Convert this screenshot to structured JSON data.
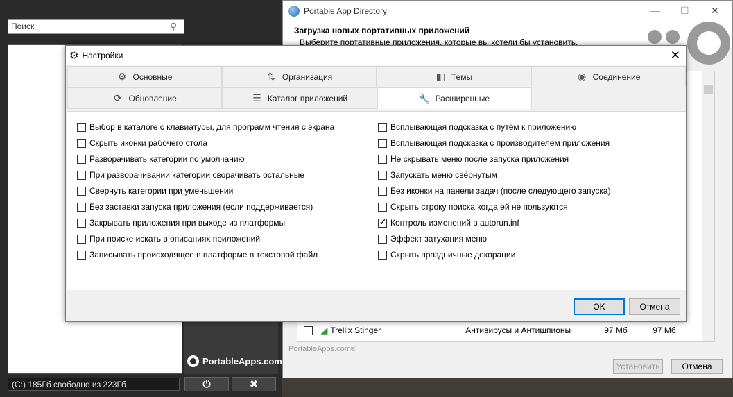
{
  "launcher": {
    "search_placeholder": "Поиск",
    "logo_text": "PortableApps.com",
    "drive_status": "(C:) 185Гб свободно из 223Гб",
    "power_icon": "power-icon",
    "close_icon": "close-icon"
  },
  "directory": {
    "title": "Portable App Directory",
    "heading": "Загрузка новых портативных приложений",
    "subheading": "Выберите портативные приложения, которые вы хотели бы установить.",
    "row": {
      "name": "Trellix Stinger",
      "category": "Антивирусы и Антишпионы",
      "size1": "97 Мб",
      "size2": "97 Мб"
    },
    "footer": "PortableApps.com®",
    "install_label": "Установить",
    "cancel_label": "Отмена"
  },
  "dialog": {
    "title": "Настройки",
    "tabs_row1": [
      {
        "label": "Основные",
        "icon": "gear-icon"
      },
      {
        "label": "Организация",
        "icon": "sort-icon"
      },
      {
        "label": "Темы",
        "icon": "theme-icon"
      },
      {
        "label": "Соединение",
        "icon": "connection-icon"
      }
    ],
    "tabs_row2": [
      {
        "label": "Обновление",
        "icon": "refresh-icon"
      },
      {
        "label": "Каталог приложений",
        "icon": "list-icon"
      },
      {
        "label": "Расширенные",
        "icon": "wrench-icon",
        "selected": true
      }
    ],
    "left_options": [
      {
        "label": "Выбор в каталоге с клавиатуры, для программ чтения с экрана",
        "checked": false
      },
      {
        "label": "Скрыть иконки рабочего стола",
        "checked": false
      },
      {
        "label": "Разворачивать категории по умолчанию",
        "checked": false
      },
      {
        "label": "При разворачивании категории сворачивать остальные",
        "checked": false
      },
      {
        "label": "Свернуть категории при уменьшении",
        "checked": false
      },
      {
        "label": "Без заставки запуска приложения (если поддерживается)",
        "checked": false
      },
      {
        "label": "Закрывать приложения при выходе из платформы",
        "checked": false
      },
      {
        "label": "При поиске искать в описаниях приложений",
        "checked": false
      },
      {
        "label": "Записывать происходящее в платформе в текстовой файл",
        "checked": false
      }
    ],
    "right_options": [
      {
        "label": "Всплывающая подсказка с путём к приложению",
        "checked": false
      },
      {
        "label": "Всплывающая подсказка с производителем приложения",
        "checked": false
      },
      {
        "label": "Не скрывать меню после запуска приложения",
        "checked": false
      },
      {
        "label": "Запускать меню свёрнутым",
        "checked": false
      },
      {
        "label": "Без иконки на панели задач (после следующего запуска)",
        "checked": false
      },
      {
        "label": "Скрыть строку поиска когда ей не пользуются",
        "checked": false
      },
      {
        "label": "Контроль изменений в autorun.inf",
        "checked": true
      },
      {
        "label": "Эффект затухания меню",
        "checked": false
      },
      {
        "label": "Скрыть праздничные декорации",
        "checked": false
      }
    ],
    "ok_label": "OK",
    "cancel_label": "Отмена"
  }
}
